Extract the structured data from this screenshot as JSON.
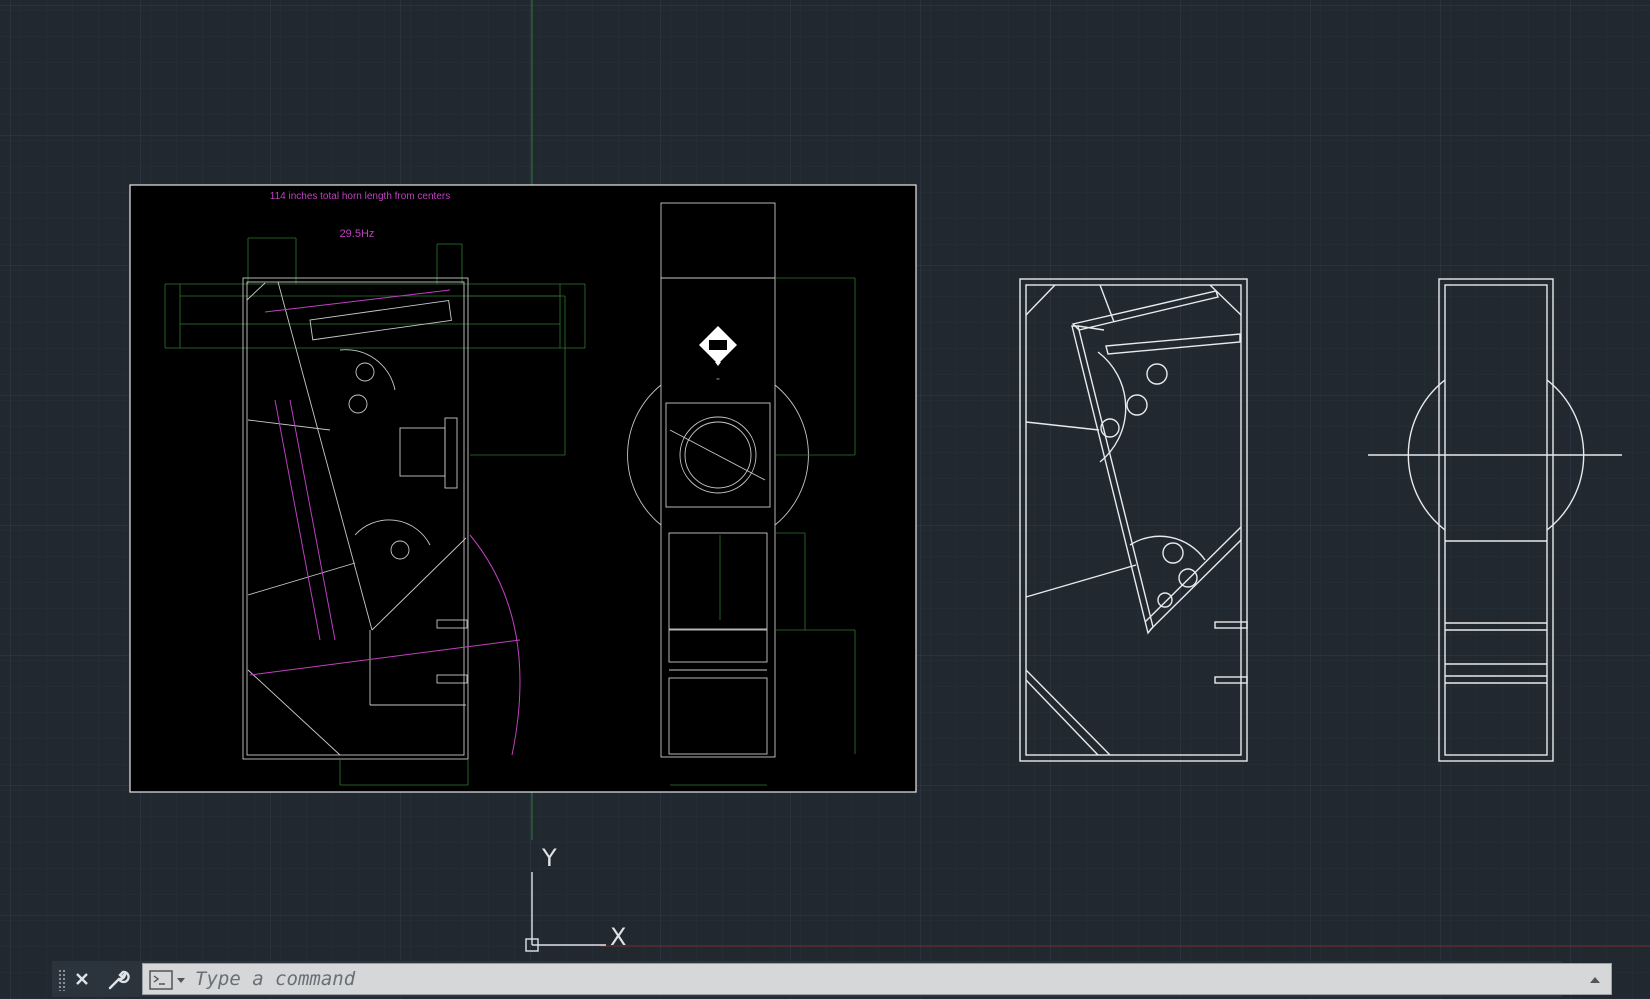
{
  "drawing": {
    "annotation_title": "114 inches total horn length from centers",
    "annotation_freq": "29.5Hz",
    "colors": {
      "background": "#212830",
      "paper": "#000000",
      "line": "#e8eaec",
      "magenta": "#c040c0",
      "green_dim": "#2f7a2f",
      "y_axis": "#2a8a3a",
      "x_axis": "#8a2a2a"
    }
  },
  "ucs": {
    "x_label": "X",
    "y_label": "Y"
  },
  "command_line": {
    "placeholder": "Type a command",
    "value": "",
    "icons": {
      "grip": "grip-icon",
      "close": "close-icon",
      "customize": "wrench-icon",
      "prompt": "command-prompt-icon",
      "history": "chevron-up-icon"
    }
  }
}
